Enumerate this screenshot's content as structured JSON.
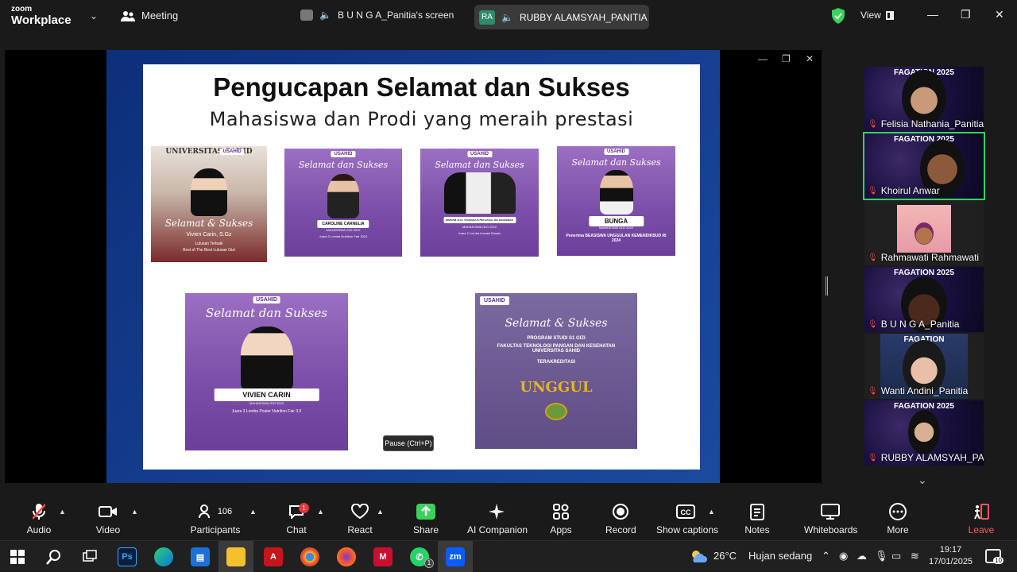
{
  "titlebar": {
    "brand_top": "zoom",
    "brand_main": "Workplace",
    "meeting_label": "Meeting",
    "share_label": "B U N G A_Panitia's screen",
    "speaker_initials": "RA",
    "speaker_name": "RUBBY ALAMSYAH_PANITIA",
    "view_label": "View",
    "colors": {
      "accent_green": "#3bd15a",
      "speaker_avatar": "#2e8b6e"
    }
  },
  "slide": {
    "title": "Pengucapan Selamat dan Sukses",
    "subtitle": "Mahasiswa dan Prodi yang meraih prestasi",
    "posters": [
      {
        "logo": "USAHID",
        "heading": "Selamat & Sukses",
        "name": "Vivien Carin, S.Gz",
        "role": "Lulusan Terbaik",
        "extra": "Best of The Best Lulusan Gizi",
        "banner": "UNIVERSITAS SAHID"
      },
      {
        "logo": "USAHID",
        "heading": "Selamat dan Sukses",
        "name": "CAROLINE CARNELIA",
        "role": "MAHASISWA GIZI 2022",
        "extra": "Juara 3 Lomba Nutrition Fair 2024"
      },
      {
        "logo": "USAHID",
        "heading": "Selamat dan Sukses",
        "name": "MARYAM ULYA, SYARAINA PUTRI AZZAH, RIA KHAMAMATI",
        "role": "MAHASISWA GIZI 2022",
        "extra": "Juara 2 Lomba Inovasi Desain"
      },
      {
        "logo": "USAHID",
        "heading": "Selamat dan Sukses",
        "name": "BUNGA",
        "role": "MAHASISWA GIZI 2022",
        "extra": "Penerima BEASISWA UNGGULAN KEMENDIKBUD RI 2024"
      },
      {
        "logo": "USAHID",
        "heading": "Selamat dan Sukses",
        "name": "VIVIEN CARIN",
        "role": "MAHASISWA GIZI 2020",
        "extra": "Juara 3 Lomba Poster Nutrition Fair 3.0"
      },
      {
        "logo": "USAHID",
        "heading": "Selamat & Sukses",
        "name": "PROGRAM STUDI S1 GIZI",
        "role": "FAKULTAS TEKNOLOGI PANGAN DAN KESEHATAN UNIVERSITAS SAHID",
        "extra": "TERAKREDITASI",
        "seal": "UNGGUL"
      }
    ],
    "tooltip": "Pause (Ctrl+P)"
  },
  "gallery": [
    {
      "name": "Felisia Nathania_Panitia",
      "bg_text": "FAGATION 2025"
    },
    {
      "name": "Khoirul Anwar",
      "bg_text": "FAGATION 2025"
    },
    {
      "name": "Rahmawati Rahmawati",
      "bg_text": ""
    },
    {
      "name": "B U N G A_Panitia",
      "bg_text": "FAGATION 2025"
    },
    {
      "name": "Wanti Andini_Panitia",
      "bg_text": "FAGATION"
    },
    {
      "name": "RUBBY ALAMSYAH_PA...",
      "bg_text": "FAGATION 2025"
    }
  ],
  "toolbar": {
    "audio": "Audio",
    "video": "Video",
    "participants": "Participants",
    "participants_count": "106",
    "chat": "Chat",
    "chat_badge": "1",
    "react": "React",
    "share": "Share",
    "ai": "AI Companion",
    "apps": "Apps",
    "record": "Record",
    "captions": "Show captions",
    "notes": "Notes",
    "whiteboards": "Whiteboards",
    "more": "More",
    "leave": "Leave",
    "colors": {
      "share_green": "#3bd15a",
      "leave_red": "#ff5a5a"
    }
  },
  "taskbar": {
    "weather_temp": "26°C",
    "weather_desc": "Hujan sedang",
    "time": "19:17",
    "date": "17/01/2025",
    "notif_count": "10",
    "whatsapp_badge": "1"
  }
}
